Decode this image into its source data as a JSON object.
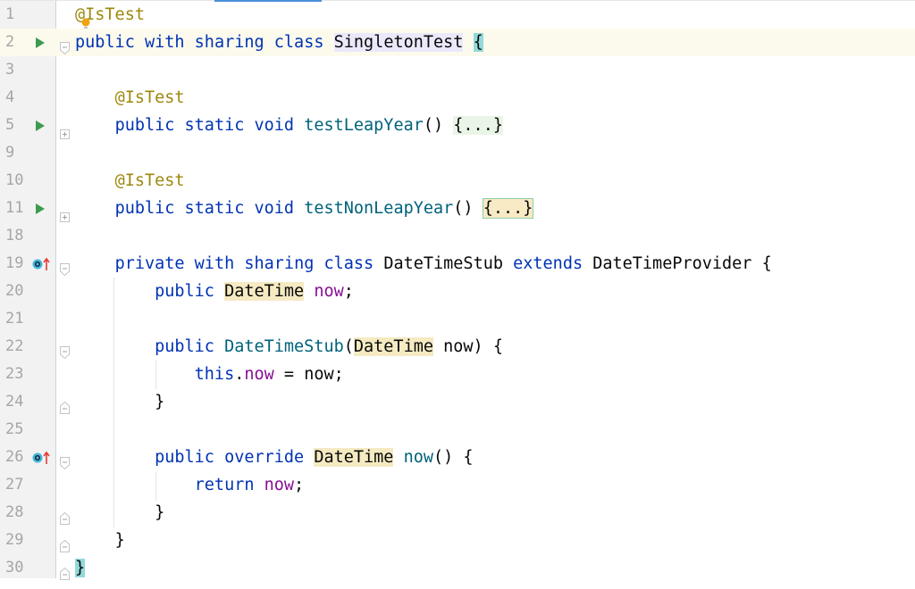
{
  "editor": {
    "language": "Apex",
    "colors": {
      "keyword": "#0033b3",
      "annotation": "#9e880d",
      "method_declaration": "#00627a",
      "field": "#871094",
      "default": "#080808",
      "current_line": "#fcfaed",
      "run_icon": "#3d9a50",
      "override_arrow": "#e53935",
      "implemented_marker": "#40b6e0"
    },
    "lines": [
      {
        "number": "1",
        "tokens": [
          "@IsTest"
        ]
      },
      {
        "number": "2",
        "tokens": [
          "public",
          "with",
          "sharing",
          "class",
          "SingletonTest",
          "{"
        ],
        "gutter_icon": "run-test",
        "current": true
      },
      {
        "number": "3",
        "tokens": []
      },
      {
        "number": "4",
        "tokens": [
          "@IsTest"
        ]
      },
      {
        "number": "5",
        "tokens": [
          "public",
          "static",
          "void",
          "testLeapYear",
          "()",
          "{...}"
        ],
        "gutter_icon": "run-test"
      },
      {
        "number": "9",
        "tokens": []
      },
      {
        "number": "10",
        "tokens": [
          "@IsTest"
        ]
      },
      {
        "number": "11",
        "tokens": [
          "public",
          "static",
          "void",
          "testNonLeapYear",
          "()",
          "{...}"
        ],
        "gutter_icon": "run-test"
      },
      {
        "number": "18",
        "tokens": []
      },
      {
        "number": "19",
        "tokens": [
          "private",
          "with",
          "sharing",
          "class",
          "DateTimeStub",
          "extends",
          "DateTimeProvider",
          "{"
        ],
        "gutter_icon": "overrides"
      },
      {
        "number": "20",
        "tokens": [
          "public",
          "DateTime",
          "now",
          ";"
        ]
      },
      {
        "number": "21",
        "tokens": []
      },
      {
        "number": "22",
        "tokens": [
          "public",
          "DateTimeStub",
          "(",
          "DateTime",
          "now",
          ")",
          "{"
        ]
      },
      {
        "number": "23",
        "tokens": [
          "this",
          ".",
          "now",
          "=",
          "now",
          ";"
        ]
      },
      {
        "number": "24",
        "tokens": [
          "}"
        ]
      },
      {
        "number": "25",
        "tokens": []
      },
      {
        "number": "26",
        "tokens": [
          "public",
          "override",
          "DateTime",
          "now",
          "()",
          "{"
        ],
        "gutter_icon": "overrides"
      },
      {
        "number": "27",
        "tokens": [
          "return",
          "now",
          ";"
        ]
      },
      {
        "number": "28",
        "tokens": [
          "}"
        ]
      },
      {
        "number": "29",
        "tokens": [
          "}"
        ]
      },
      {
        "number": "30",
        "tokens": [
          "}"
        ]
      }
    ]
  },
  "icons": {
    "run": "run-test-icon",
    "overrides": "overrides-method-icon",
    "intention": "intention-bulb-icon",
    "fold": "fold-marker-icon"
  }
}
